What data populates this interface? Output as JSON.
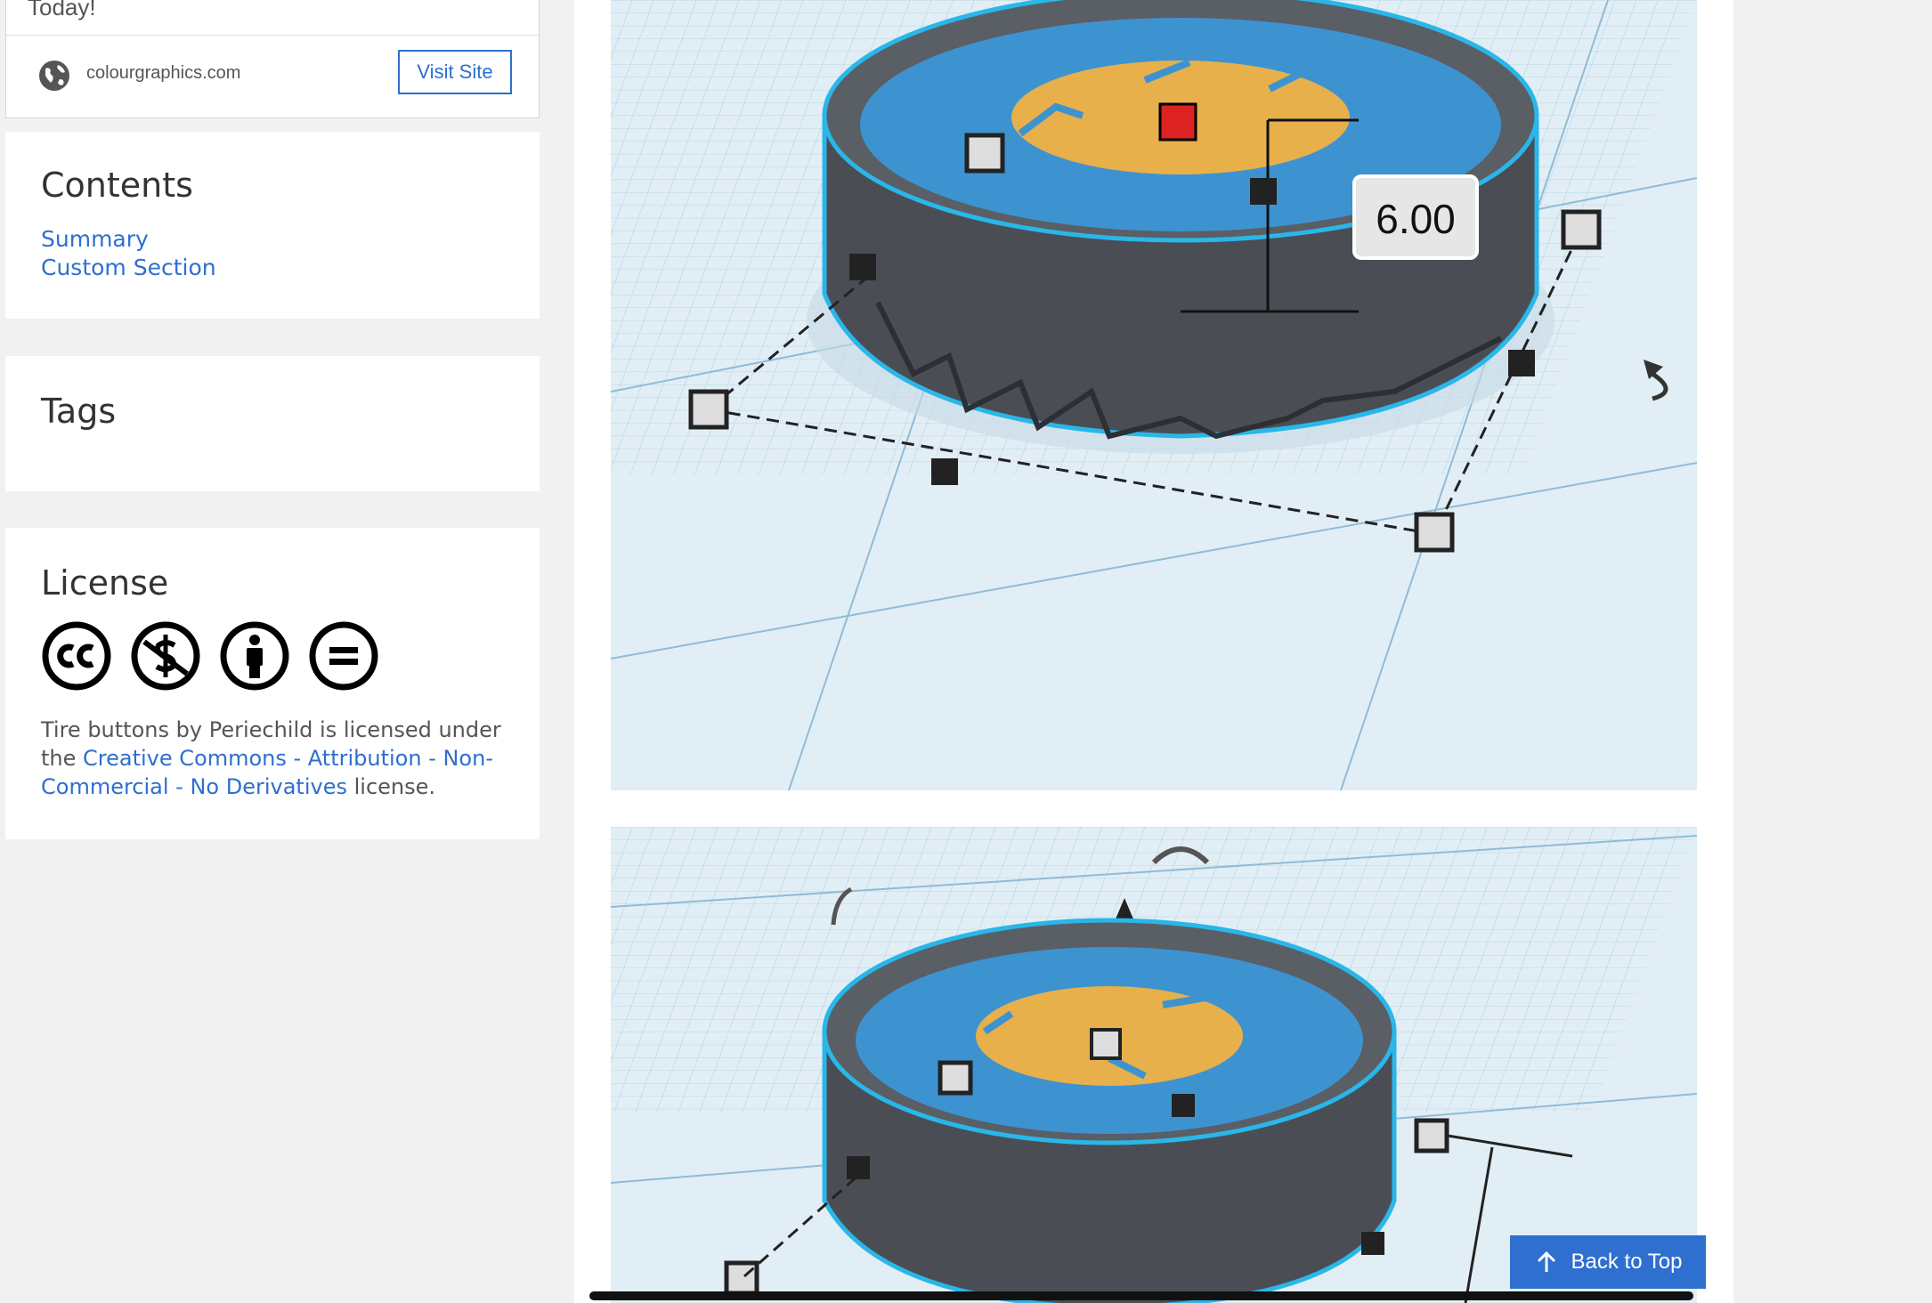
{
  "ad": {
    "partial_text": "Today!",
    "domain": "colourgraphics.com",
    "visit_label": "Visit Site",
    "globe_icon": "globe-icon"
  },
  "contents": {
    "title": "Contents",
    "links": [
      "Summary",
      "Custom Section"
    ]
  },
  "tags": {
    "title": "Tags"
  },
  "license": {
    "title": "License",
    "icons": [
      "cc-icon",
      "non-commercial-icon",
      "attribution-icon",
      "no-derivatives-icon"
    ],
    "text_thing": "Tire buttons",
    "text_by": "by",
    "author": "Periechild",
    "text_licensed": "is licensed under the",
    "license_link": "Creative Commons - Attribution - Non-Commercial - No Derivatives",
    "text_end": "license."
  },
  "images": {
    "dimension_label": "6.00"
  },
  "back_to_top": {
    "label": "Back to Top",
    "icon": "arrow-up-icon"
  },
  "colors": {
    "link": "#2e6fcf",
    "button": "#2e6fcf",
    "page_bg": "#f1f1f1",
    "grid_bg": "#dceaf3",
    "tire": "#4a4e54",
    "rim": "#3d93d0",
    "hub": "#e7b04b",
    "outline": "#29b7ea"
  }
}
